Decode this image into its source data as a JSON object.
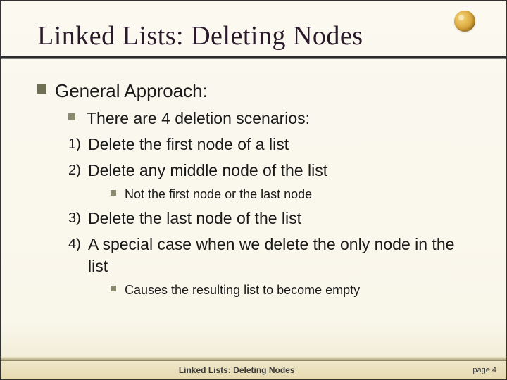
{
  "title": "Linked Lists:  Deleting Nodes",
  "logo": {
    "name": "gold-orb-logo"
  },
  "content": {
    "h1": "General Approach:",
    "intro": "There are 4 deletion scenarios:",
    "items": [
      {
        "marker": "1)",
        "text": "Delete the first node of a list"
      },
      {
        "marker": "2)",
        "text": "Delete any middle node of the list",
        "sub": "Not the first node or the last node"
      },
      {
        "marker": "3)",
        "text": "Delete the last node of the list"
      },
      {
        "marker": "4)",
        "text": "A special case when we delete the only node in the list",
        "sub": "Causes the resulting list to become empty"
      }
    ]
  },
  "footer": {
    "center": "Linked Lists: Deleting Nodes",
    "page_label": "page 4"
  }
}
